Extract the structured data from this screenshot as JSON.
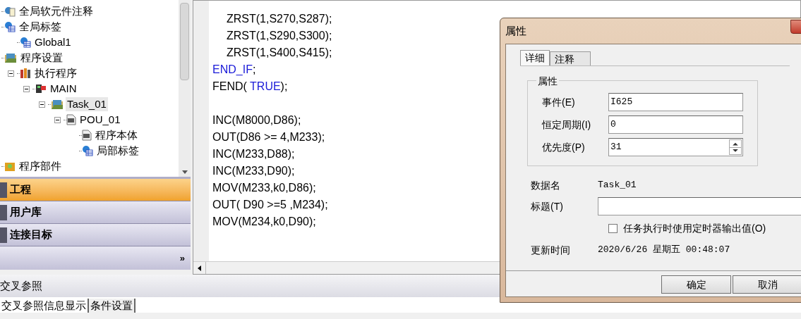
{
  "tree": [
    {
      "label": "全局软元件注释",
      "kind": "comment",
      "selected": false
    },
    {
      "label": "全局标签",
      "kind": "globe",
      "selected": false,
      "children": [
        {
          "label": "Global1",
          "kind": "globe",
          "selected": false
        }
      ]
    },
    {
      "label": "程序设置",
      "kind": "folder",
      "selected": false,
      "children": [
        {
          "label": "执行程序",
          "kind": "books",
          "selected": false,
          "expanded": true,
          "children": [
            {
              "label": "MAIN",
              "kind": "main",
              "selected": false,
              "expanded": true,
              "children": [
                {
                  "label": "Task_01",
                  "kind": "folder",
                  "selected": true,
                  "expanded": true,
                  "children": [
                    {
                      "label": "POU_01",
                      "kind": "st",
                      "selected": false,
                      "expanded": true,
                      "children": [
                        {
                          "label": "程序本体",
                          "kind": "st",
                          "selected": false
                        },
                        {
                          "label": "局部标签",
                          "kind": "globe",
                          "selected": false
                        }
                      ]
                    }
                  ]
                }
              ]
            }
          ]
        }
      ]
    },
    {
      "label": "程序部件",
      "kind": "parts",
      "selected": false
    }
  ],
  "nav": [
    {
      "label": "工程",
      "selected": true
    },
    {
      "label": "用户库",
      "selected": false
    },
    {
      "label": "连接目标",
      "selected": false
    }
  ],
  "nav_more": "»",
  "code": [
    {
      "kind": "code",
      "indented": true,
      "parts": [
        {
          "text": "ZRST(1,S270,S287);",
          "kind": "plain"
        }
      ]
    },
    {
      "kind": "code",
      "indented": true,
      "parts": [
        {
          "text": "ZRST(1,S290,S300);",
          "kind": "plain"
        }
      ]
    },
    {
      "kind": "code",
      "indented": true,
      "parts": [
        {
          "text": "ZRST(1,S400,S415);",
          "kind": "plain"
        }
      ]
    },
    {
      "kind": "code",
      "indented": false,
      "parts": [
        {
          "text": "END_IF",
          "kind": "keyword"
        },
        {
          "text": ";",
          "kind": "plain"
        }
      ]
    },
    {
      "kind": "code",
      "indented": false,
      "parts": [
        {
          "text": "FEND( ",
          "kind": "plain"
        },
        {
          "text": "TRUE",
          "kind": "keyword"
        },
        {
          "text": ");",
          "kind": "plain"
        }
      ]
    },
    {
      "kind": "blank"
    },
    {
      "kind": "code",
      "indented": false,
      "parts": [
        {
          "text": "INC(M8000,D86);",
          "kind": "plain"
        }
      ]
    },
    {
      "kind": "code",
      "indented": false,
      "parts": [
        {
          "text": "OUT(D86 >= 4,M233);",
          "kind": "plain"
        }
      ]
    },
    {
      "kind": "code",
      "indented": false,
      "parts": [
        {
          "text": "INC(M233,D88);",
          "kind": "plain"
        }
      ]
    },
    {
      "kind": "code",
      "indented": false,
      "parts": [
        {
          "text": "INC(M233,D90);",
          "kind": "plain"
        }
      ]
    },
    {
      "kind": "code",
      "indented": false,
      "parts": [
        {
          "text": "MOV(M233,k0,D86);",
          "kind": "plain"
        }
      ]
    },
    {
      "kind": "code",
      "indented": false,
      "parts": [
        {
          "text": "OUT( D90 >=5 ,M234);",
          "kind": "plain"
        }
      ]
    },
    {
      "kind": "code",
      "indented": false,
      "parts": [
        {
          "text": "MOV(M234,k0,D90);",
          "kind": "plain"
        }
      ]
    }
  ],
  "cross_ref": {
    "title": "交叉参照",
    "tabs": [
      {
        "label": "交叉参照信息显示",
        "selected": true
      },
      {
        "label": "条件设置",
        "selected": false
      }
    ]
  },
  "dialog": {
    "title": "属性",
    "tabs": [
      {
        "label": "详细",
        "selected": true
      },
      {
        "label": "注释",
        "selected": false
      }
    ],
    "group_title": "属性",
    "fields": [
      {
        "label": "事件(E)",
        "value": "I625",
        "kind": "text"
      },
      {
        "label": "恒定周期(I)",
        "value": "0",
        "kind": "text"
      },
      {
        "label": "优先度(P)",
        "value": "31",
        "kind": "spin"
      }
    ],
    "data_name_label": "数据名",
    "data_name": "Task_01",
    "caption_label": "标题(T)",
    "checkbox": {
      "label": "任务执行时使用定时器输出值(O)",
      "checked": false
    },
    "updated_label": "更新时间",
    "updated": "2020/6/26 星期五 00:48:07",
    "buttons": [
      "确定",
      "取消"
    ]
  }
}
